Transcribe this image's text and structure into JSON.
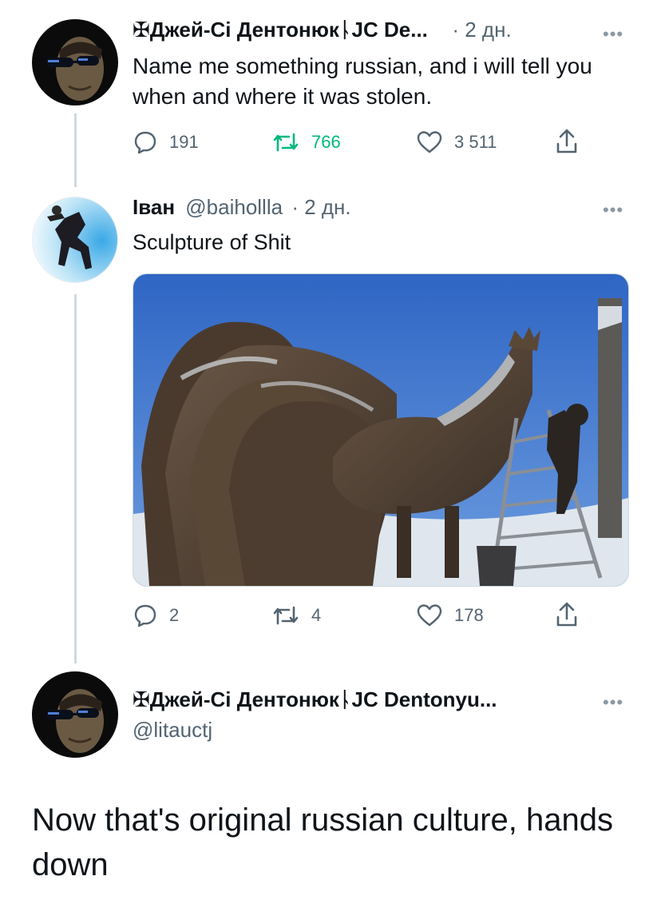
{
  "tweets": [
    {
      "author": "✠Джей-Сі ДентонюкᚿJC De...",
      "time": "· 2 дн.",
      "text": "Name me something russian, and i will tell you when and where it was stolen.",
      "replies": "191",
      "retweets": "766",
      "likes": "3 511"
    },
    {
      "author": "Іван",
      "handle": "@baihollla",
      "time": "· 2 дн.",
      "text": "Sculpture of Shit",
      "replies": "2",
      "retweets": "4",
      "likes": "178"
    }
  ],
  "main_tweet": {
    "author": "✠Джей-Сі ДентонюкᚿJC Dentonyu...",
    "handle": "@litauctj",
    "text": "Now that's original russian culture, hands down"
  },
  "colors": {
    "text": "#0f1419",
    "muted": "#536471",
    "retweet_active": "#00ba7c",
    "thread_line": "#cfd9de"
  },
  "icons": [
    "reply-icon",
    "retweet-icon",
    "like-icon",
    "share-icon",
    "more-icon"
  ]
}
